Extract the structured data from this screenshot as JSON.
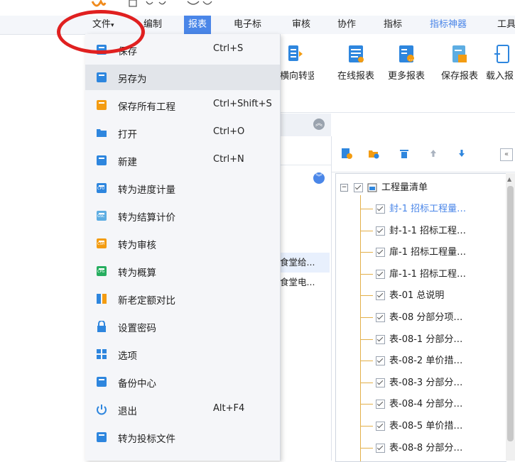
{
  "menubar": {
    "tabs": [
      {
        "label": "文件",
        "arrow": "▾"
      },
      {
        "label": "编制"
      },
      {
        "label": "报表"
      },
      {
        "label": "电子标"
      },
      {
        "label": "审核"
      },
      {
        "label": "协作"
      },
      {
        "label": "指标"
      },
      {
        "label": "指标神器"
      },
      {
        "label": "工具"
      }
    ]
  },
  "ribbon": {
    "buttons": [
      {
        "label": "横向转竖向",
        "icon": "orientation-icon"
      },
      {
        "label": "在线报表",
        "icon": "online-report-icon"
      },
      {
        "label": "更多报表",
        "icon": "more-reports-icon"
      },
      {
        "label": "保存报表",
        "icon": "save-report-icon"
      },
      {
        "label": "载入报",
        "icon": "load-report-icon"
      }
    ]
  },
  "file_menu": {
    "items": [
      {
        "label": "保存",
        "shortcut": "Ctrl+S",
        "icon": "floppy-icon"
      },
      {
        "label": "另存为",
        "shortcut": "",
        "icon": "save-as-icon"
      },
      {
        "label": "保存所有工程",
        "shortcut": "Ctrl+Shift+S",
        "icon": "save-all-icon"
      },
      {
        "label": "打开",
        "shortcut": "Ctrl+O",
        "icon": "folder-icon"
      },
      {
        "label": "新建",
        "shortcut": "Ctrl+N",
        "icon": "new-file-icon"
      },
      {
        "label": "转为进度计量",
        "shortcut": "",
        "icon": "convert-progress-icon"
      },
      {
        "label": "转为结算计价",
        "shortcut": "",
        "icon": "convert-settlement-icon"
      },
      {
        "label": "转为审核",
        "shortcut": "",
        "icon": "convert-audit-icon"
      },
      {
        "label": "转为概算",
        "shortcut": "",
        "icon": "convert-estimate-icon"
      },
      {
        "label": "新老定额对比",
        "shortcut": "",
        "icon": "compare-icon"
      },
      {
        "label": "设置密码",
        "shortcut": "",
        "icon": "lock-icon"
      },
      {
        "label": "选项",
        "shortcut": "",
        "icon": "grid-icon"
      },
      {
        "label": "备份中心",
        "shortcut": "",
        "icon": "backup-icon"
      },
      {
        "label": "退出",
        "shortcut": "Alt+F4",
        "icon": "power-icon"
      },
      {
        "label": "转为投标文件",
        "shortcut": "",
        "icon": "bid-file-icon"
      }
    ]
  },
  "left_panel": {
    "rows": [
      {
        "label": "食堂给..."
      },
      {
        "label": "食堂电..."
      }
    ]
  },
  "tree": {
    "root": "工程量清单",
    "nodes": [
      {
        "label": "封-1 招标工程量…",
        "selected": true
      },
      {
        "label": "封-1-1 招标工程…"
      },
      {
        "label": "扉-1 招标工程量…"
      },
      {
        "label": "扉-1-1 招标工程…"
      },
      {
        "label": "表-01 总说明"
      },
      {
        "label": "表-08 分部分项…"
      },
      {
        "label": "表-08-1 分部分…"
      },
      {
        "label": "表-08-2 单价措…"
      },
      {
        "label": "表-08-3 分部分…"
      },
      {
        "label": "表-08-4 分部分…"
      },
      {
        "label": "表-08-5 单价措…"
      },
      {
        "label": "表-08-8 分部分…"
      }
    ]
  },
  "colors": {
    "accent": "#4a86e8",
    "annotation_circle": "#e02020",
    "tree_line": "#e3b04b"
  }
}
